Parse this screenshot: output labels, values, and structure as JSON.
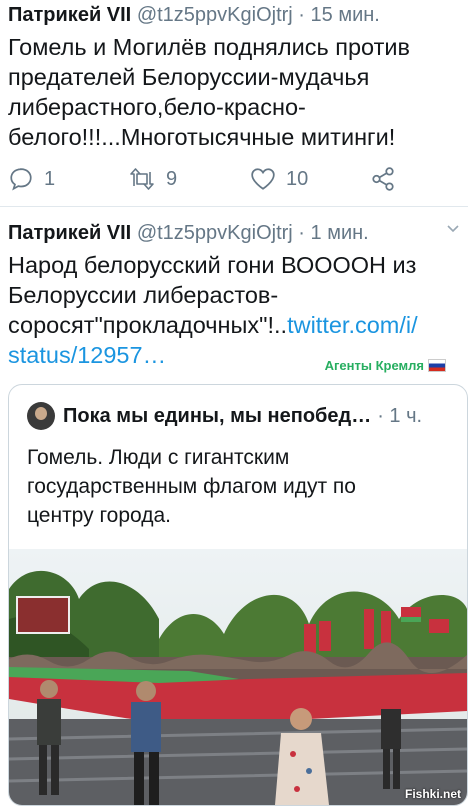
{
  "tweet1": {
    "name": "Патрикей VII",
    "handle": "@t1z5ppvKgiOjtrj",
    "time": "· 15 мин.",
    "text_lines": [
      "Гомель и Могилёв поднялись против",
      "предателей Белоруссии-мудачья",
      "либерастного,бело-красно-",
      "белого!!!...Многотысячные митинги!"
    ],
    "reply_count": "1",
    "retweet_count": "9",
    "like_count": "10"
  },
  "tweet2": {
    "name": "Патрикей VII",
    "handle": "@t1z5ppvKgiOjtrj",
    "time": "· 1 мин.",
    "text_lines": [
      "Народ белорусский гони ВООООН из",
      "Белоруссии либерастов-",
      "соросят\"прокладочных\"!.."
    ],
    "link_part1": "twitter.com/i/",
    "link_part2": "status/12957…"
  },
  "watermark": {
    "label": "Агенты Кремля"
  },
  "quote": {
    "name": "Пока мы едины, мы непобед…",
    "time": "· 1 ч.",
    "text_lines": [
      "Гомель. Люди с гигантским",
      "государственным флагом идут по",
      "центру города."
    ]
  },
  "site_watermark": "Fishki.net",
  "colors": {
    "link": "#1b95e0",
    "secondary": "#657786",
    "agents_label": "#27ae60",
    "flag_red": "#c8313e",
    "flag_green": "#4aa657"
  }
}
